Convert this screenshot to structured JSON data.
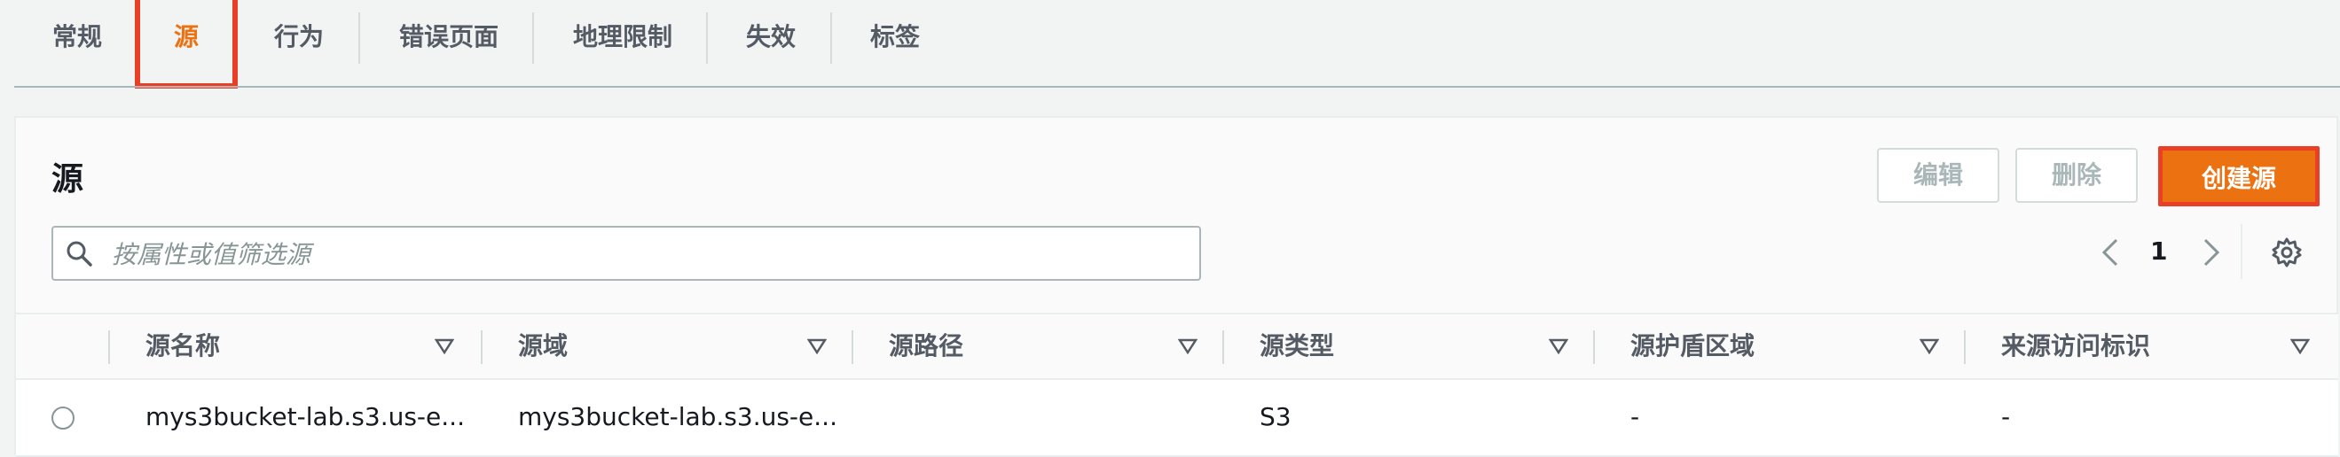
{
  "tabs": [
    {
      "label": "常规"
    },
    {
      "label": "源"
    },
    {
      "label": "行为"
    },
    {
      "label": "错误页面"
    },
    {
      "label": "地理限制"
    },
    {
      "label": "失效"
    },
    {
      "label": "标签"
    }
  ],
  "panel": {
    "title": "源",
    "buttons": {
      "edit": "编辑",
      "delete": "删除",
      "create": "创建源"
    },
    "search": {
      "placeholder": "按属性或值筛选源",
      "value": ""
    },
    "pagination": {
      "current_page": "1"
    }
  },
  "table": {
    "columns": [
      "源名称",
      "源域",
      "源路径",
      "源类型",
      "源护盾区域",
      "来源访问标识"
    ],
    "rows": [
      {
        "name": "mys3bucket-lab.s3.us-e...",
        "domain": "mys3bucket-lab.s3.us-e...",
        "path": "",
        "type": "S3",
        "shield_region": "-",
        "access_identity": "-"
      }
    ]
  },
  "colors": {
    "accent": "#ec7211",
    "highlight_box": "#e83f26",
    "disabled_text": "#aab7b8"
  },
  "icons": [
    "search-icon",
    "chevron-left-icon",
    "chevron-right-icon",
    "gear-icon",
    "sort-down-icon"
  ]
}
